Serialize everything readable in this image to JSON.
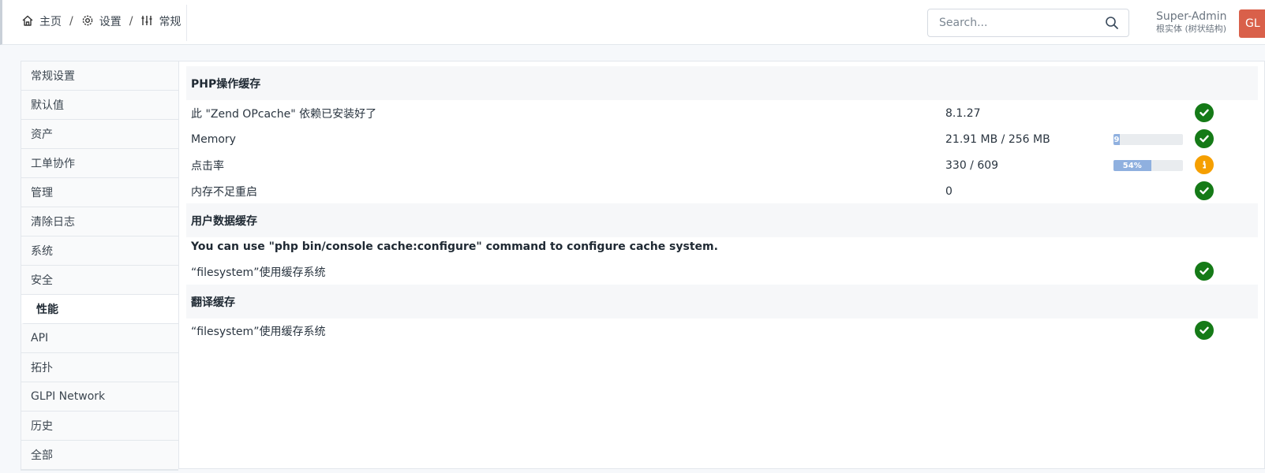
{
  "breadcrumb": {
    "home": {
      "label": "主页",
      "icon": "home-icon"
    },
    "settings": {
      "label": "设置",
      "icon": "gear-icon"
    },
    "general": {
      "label": "常规",
      "icon": "sliders-icon"
    },
    "separator": "/"
  },
  "search": {
    "placeholder": "Search...",
    "value": "",
    "icon": "search-icon"
  },
  "user": {
    "name": "Super-Admin",
    "entity": "根实体 (树状结构)",
    "avatar_initials": "GL",
    "avatar_color": "#d9604a"
  },
  "sidebar": {
    "items": [
      {
        "label": "常规设置",
        "active": false
      },
      {
        "label": "默认值",
        "active": false
      },
      {
        "label": "资产",
        "active": false
      },
      {
        "label": "工单协作",
        "active": false
      },
      {
        "label": "管理",
        "active": false
      },
      {
        "label": "清除日志",
        "active": false
      },
      {
        "label": "系统",
        "active": false
      },
      {
        "label": "安全",
        "active": false
      },
      {
        "label": "性能",
        "active": true
      },
      {
        "label": "API",
        "active": false
      },
      {
        "label": "拓扑",
        "active": false
      },
      {
        "label": "GLPI Network",
        "active": false
      },
      {
        "label": "历史",
        "active": false
      },
      {
        "label": "全部",
        "active": false
      }
    ]
  },
  "panel": {
    "opcache": {
      "title": "PHP操作缓存",
      "rows": [
        {
          "label": "此 \"Zend OPcache\" 依赖已安装好了",
          "value": "8.1.27",
          "status": "ok"
        },
        {
          "label": "Memory",
          "value": "21.91 MB / 256 MB",
          "progress": 0.09,
          "progress_text": "9",
          "status": "ok"
        },
        {
          "label": "点击率",
          "value": "330 / 609",
          "progress": 0.54,
          "progress_text": "54%",
          "status": "info"
        },
        {
          "label": "内存不足重启",
          "value": "0",
          "status": "ok"
        }
      ]
    },
    "user_cache": {
      "title": "用户数据缓存",
      "note": "You can use \"php bin/console cache:configure\" command to configure cache system.",
      "row": {
        "label": "“filesystem”使用缓存系统",
        "status": "ok"
      }
    },
    "translation_cache": {
      "title": "翻译缓存",
      "row": {
        "label": "“filesystem”使用缓存系统",
        "status": "ok"
      }
    }
  },
  "colors": {
    "ok": "#157a17",
    "info": "#f59f00",
    "progress": "#8fb0df"
  }
}
